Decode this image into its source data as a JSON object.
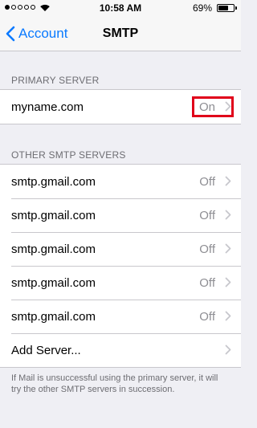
{
  "status_bar": {
    "time": "10:58 AM",
    "battery_percent": "69%",
    "battery_level": 0.69,
    "signal_bars_filled": 1,
    "signal_bars_total": 5
  },
  "nav": {
    "back_label": "Account",
    "title": "SMTP"
  },
  "primary": {
    "header": "PRIMARY SERVER",
    "server": {
      "name": "myname.com",
      "status": "On"
    }
  },
  "other": {
    "header": "OTHER SMTP SERVERS",
    "servers": [
      {
        "name": "smtp.gmail.com",
        "status": "Off"
      },
      {
        "name": "smtp.gmail.com",
        "status": "Off"
      },
      {
        "name": "smtp.gmail.com",
        "status": "Off"
      },
      {
        "name": "smtp.gmail.com",
        "status": "Off"
      },
      {
        "name": "smtp.gmail.com",
        "status": "Off"
      }
    ],
    "add_label": "Add Server..."
  },
  "footer_text": "If Mail is unsuccessful using the primary server, it will try the other SMTP servers in succession.",
  "colors": {
    "accent": "#0a7aff",
    "highlight": "#e0001a"
  }
}
